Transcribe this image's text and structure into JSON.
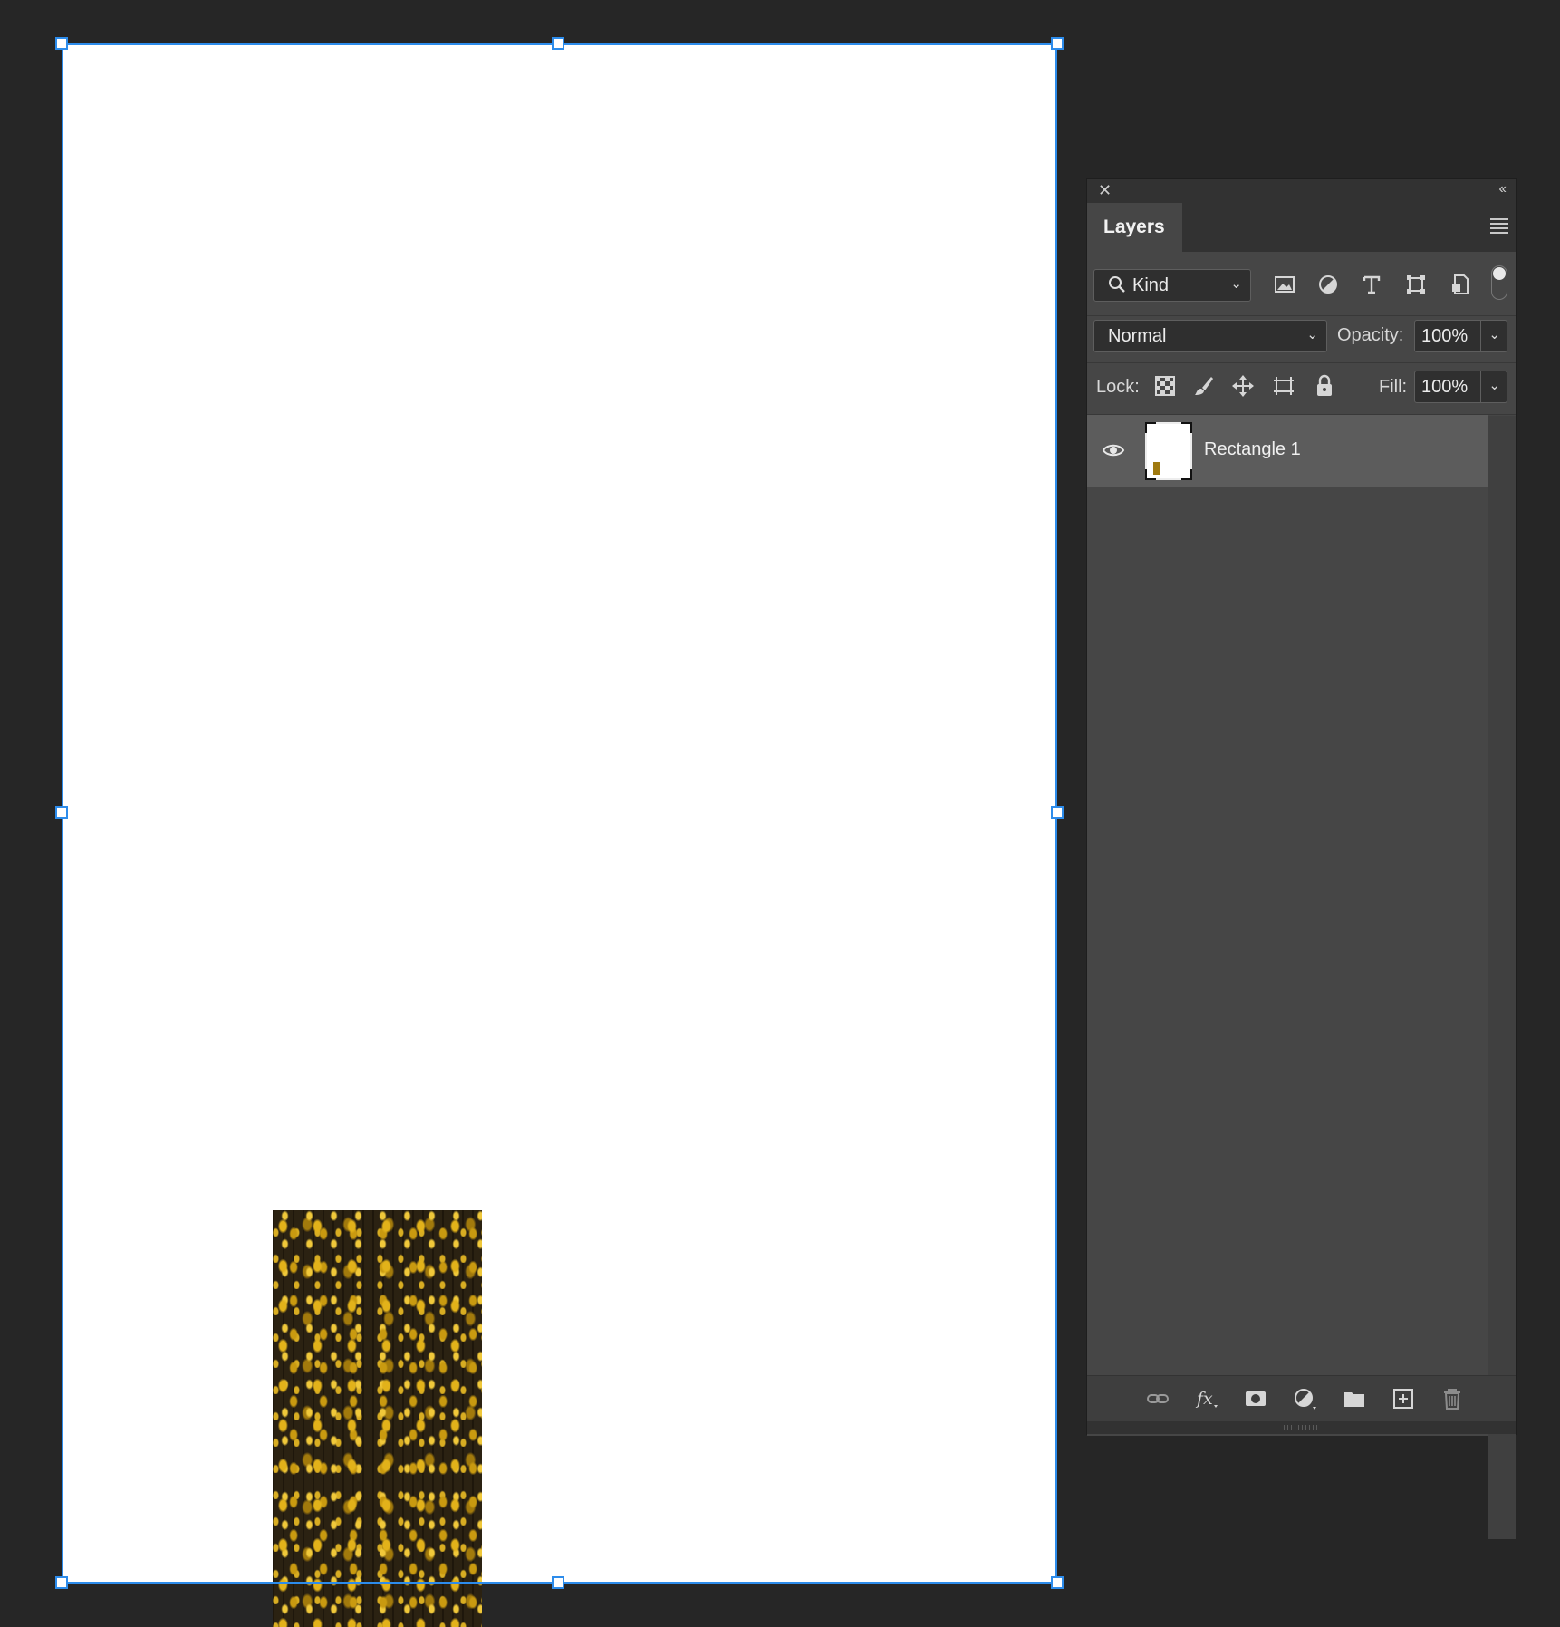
{
  "panel": {
    "tab_label": "Layers",
    "filter": {
      "label": "Kind"
    },
    "blend_mode": "Normal",
    "opacity_label": "Opacity:",
    "opacity_value": "100%",
    "lock_label": "Lock:",
    "fill_label": "Fill:",
    "fill_value": "100%",
    "layers": [
      {
        "name": "Rectangle 1",
        "visible": true,
        "selected": true
      }
    ]
  },
  "colors": {
    "selection": "#2d8ceb",
    "canvas_bg": "#ffffff",
    "workspace_bg": "#262626",
    "panel_bg": "#464646",
    "selected_layer_bg": "#5c5c5c"
  },
  "icons": {
    "filter_row": [
      "search-icon",
      "chevron-down-icon",
      "image-filter-icon",
      "adjustment-filter-icon",
      "type-filter-icon",
      "shape-filter-icon",
      "smart-object-filter-icon",
      "filter-toggle-icon"
    ],
    "lock_row": [
      "lock-transparent-icon",
      "lock-image-icon",
      "lock-position-icon",
      "lock-artboard-icon",
      "lock-all-icon"
    ],
    "bottom_bar": [
      "link-layers-icon",
      "fx-icon",
      "add-mask-icon",
      "new-adjustment-icon",
      "new-group-icon",
      "new-layer-icon",
      "delete-layer-icon"
    ]
  }
}
